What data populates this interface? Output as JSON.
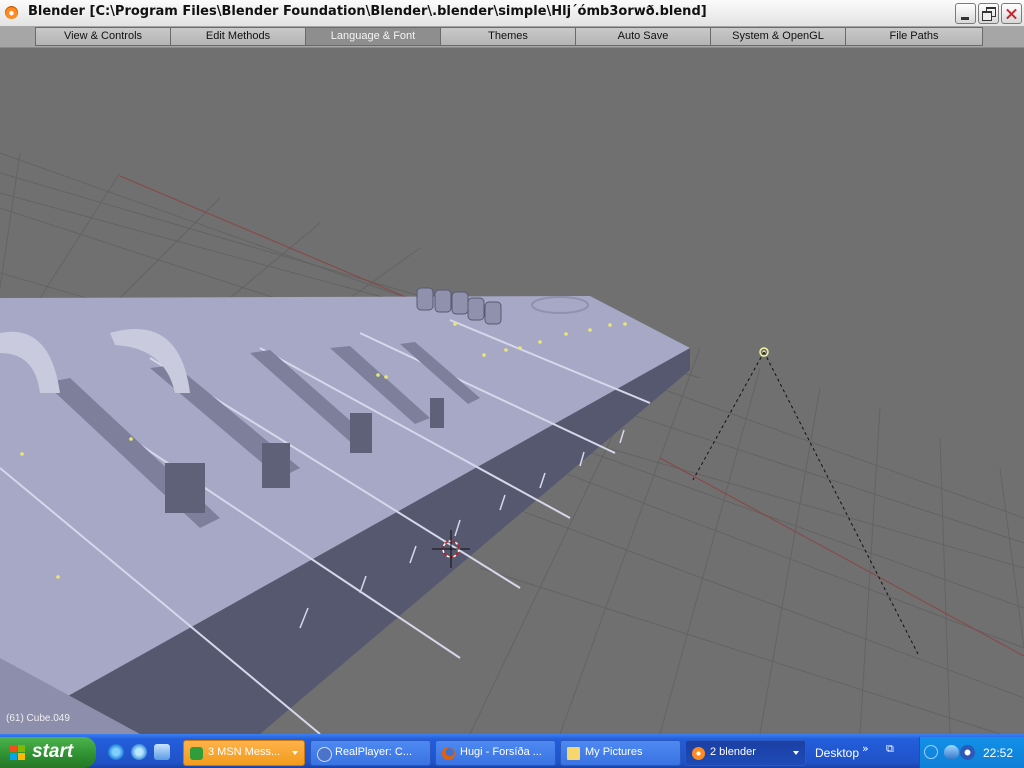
{
  "window": {
    "title": "Blender [C:\\Program Files\\Blender Foundation\\Blender\\.blender\\simple\\Hlj´ómb3orwð.blend]",
    "app_icon": "blender-icon",
    "controls": [
      "minimize",
      "maximize",
      "close"
    ]
  },
  "preferences": {
    "tabs": [
      {
        "label": "View & Controls",
        "active": false
      },
      {
        "label": "Edit Methods",
        "active": false
      },
      {
        "label": "Language & Font",
        "active": true
      },
      {
        "label": "Themes",
        "active": false
      },
      {
        "label": "Auto Save",
        "active": false
      },
      {
        "label": "System & OpenGL",
        "active": false
      },
      {
        "label": "File Paths",
        "active": false
      }
    ]
  },
  "viewport": {
    "object_info": "(61) Cube.049",
    "background_color": "#707070",
    "mesh_color": "#a6a8c6",
    "grid_color": "#636363",
    "x_axis_color": "#8a4646"
  },
  "taskbar": {
    "start_label": "start",
    "quick_launch": [
      "internet-explorer-icon",
      "msn-icon",
      "show-desktop-icon"
    ],
    "tasks": [
      {
        "label": "3 MSN Mess...",
        "icon": "msn-messenger-icon",
        "state": "alert",
        "grouped": true
      },
      {
        "label": "RealPlayer: C...",
        "icon": "realplayer-icon",
        "state": "normal",
        "grouped": false
      },
      {
        "label": "Hugi - Forsíða ...",
        "icon": "firefox-icon",
        "state": "normal",
        "grouped": false
      },
      {
        "label": "My Pictures",
        "icon": "folder-icon",
        "state": "normal",
        "grouped": false
      },
      {
        "label": "2 blender",
        "icon": "blender-icon",
        "state": "active",
        "grouped": true
      }
    ],
    "desktop_toolbar": "Desktop",
    "tray_icons": [
      "show-hidden-icons-arrow",
      "network-icon",
      "audio-icon",
      "msn-tray-icon"
    ],
    "clock": "22:52"
  }
}
